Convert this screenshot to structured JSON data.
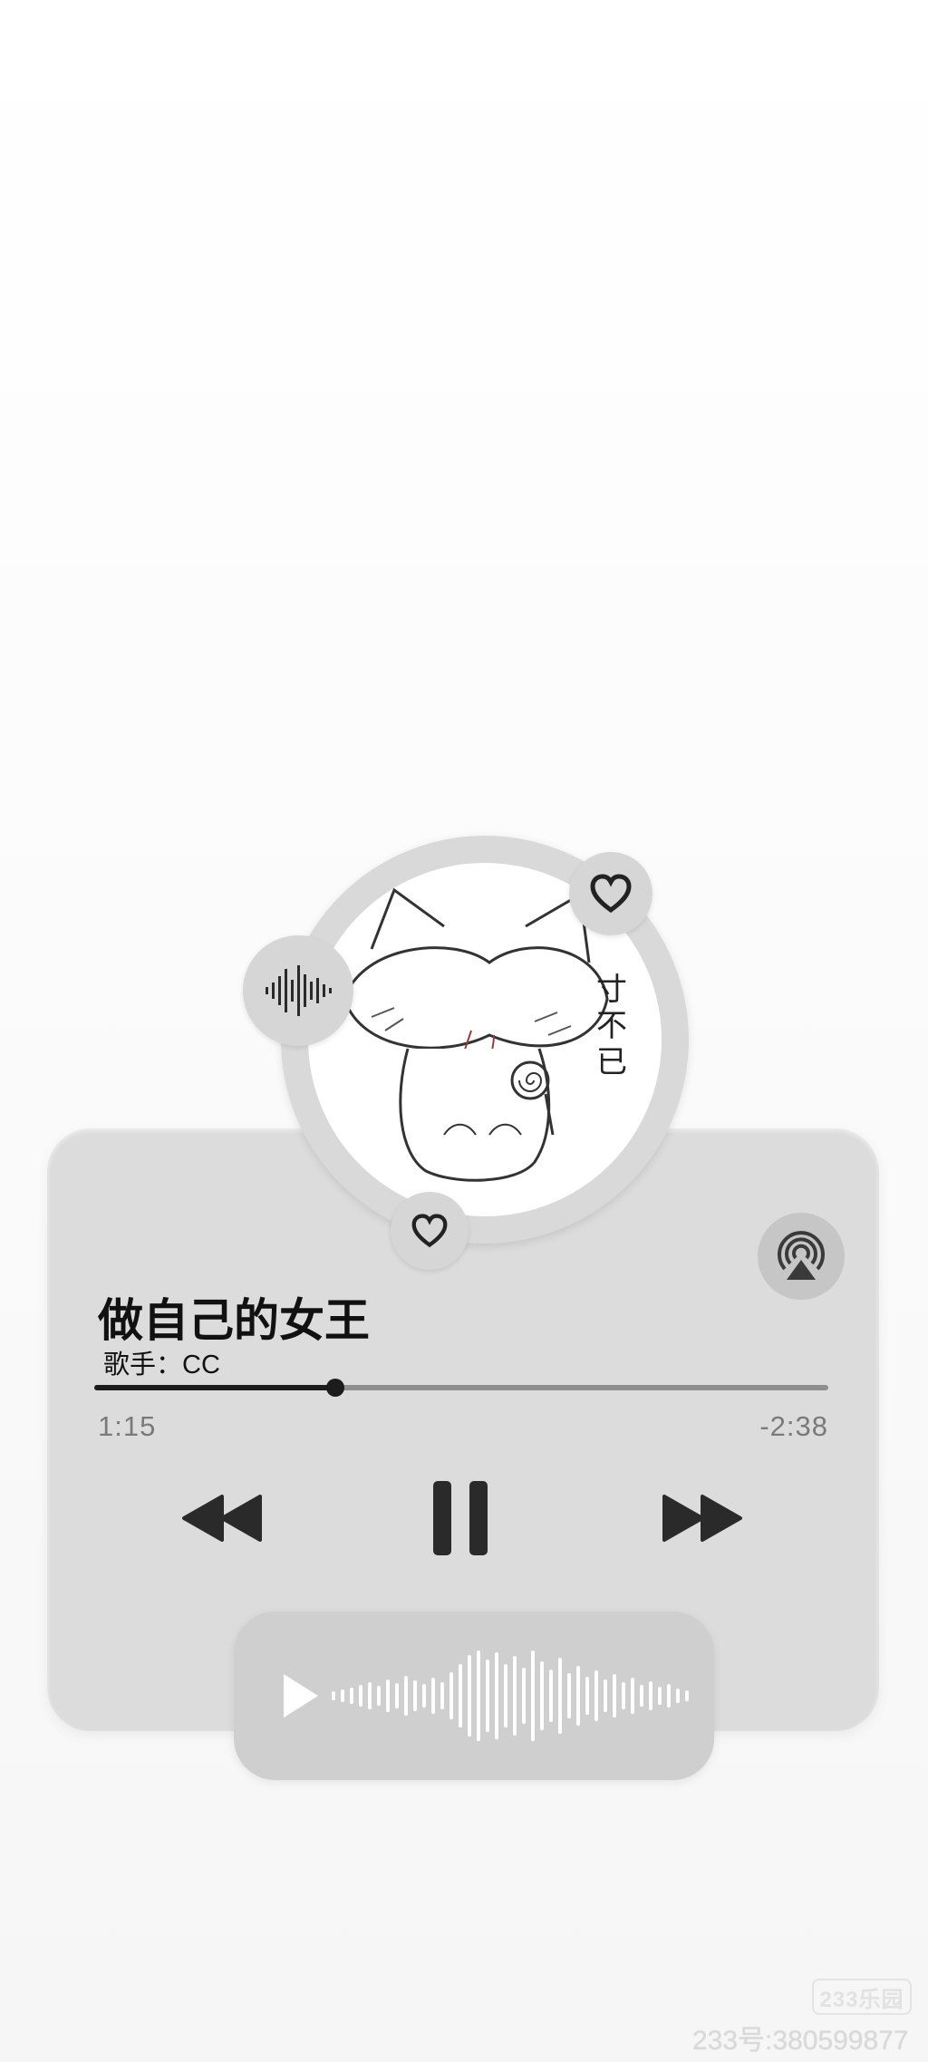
{
  "player": {
    "song_title": "做自己的女王",
    "artist_label": "歌手：CC",
    "time_elapsed": "1:15",
    "time_remaining": "-2:38",
    "progress_fraction": 0.328,
    "state": "playing"
  },
  "album_art": {
    "handwritten_text": "寸不已"
  },
  "icons": {
    "waveform_bubble": "waveform-icon",
    "favorite_top": "heart-icon",
    "favorite_bottom": "heart-icon",
    "airplay": "airplay-icon",
    "rewind": "rewind-icon",
    "pause": "pause-icon",
    "forward": "fast-forward-icon",
    "mini_play": "play-icon"
  },
  "watermark": {
    "logo_text": "233乐园",
    "id_text": "233号:380599877"
  },
  "colors": {
    "card": "#dcdcdc",
    "accent_dark": "#1c1c1c",
    "muted_text": "#7a7a7a",
    "wave_bar": "#ffffff"
  }
}
